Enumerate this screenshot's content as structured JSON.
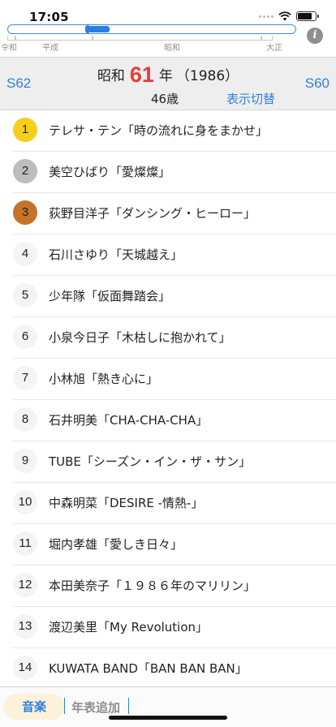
{
  "status_bar": {
    "time": "17:05"
  },
  "timeline": {
    "eras": [
      "令和",
      "平成",
      "昭和",
      "大正"
    ],
    "position_fraction": 0.31
  },
  "header": {
    "prev_label": "S62",
    "next_label": "S60",
    "era": "昭和",
    "era_year": "61",
    "nen": "年",
    "western_year": "（1986）",
    "age": "46歳",
    "toggle_label": "表示切替"
  },
  "ranking": [
    {
      "rank": "1",
      "title": "テレサ・テン「時の流れに身をまかせ」"
    },
    {
      "rank": "2",
      "title": "美空ひばり「愛燦燦」"
    },
    {
      "rank": "3",
      "title": "荻野目洋子「ダンシング・ヒーロー」"
    },
    {
      "rank": "4",
      "title": "石川さゆり「天城越え」"
    },
    {
      "rank": "5",
      "title": "少年隊「仮面舞踏会」"
    },
    {
      "rank": "6",
      "title": "小泉今日子「木枯しに抱かれて」"
    },
    {
      "rank": "7",
      "title": "小林旭「熱き心に」"
    },
    {
      "rank": "8",
      "title": "石井明美「CHA-CHA-CHA」"
    },
    {
      "rank": "9",
      "title": "TUBE「シーズン・イン・ザ・サン」"
    },
    {
      "rank": "10",
      "title": "中森明菜「DESIRE -情熱-」"
    },
    {
      "rank": "11",
      "title": "堀内孝雄「愛しき日々」"
    },
    {
      "rank": "12",
      "title": "本田美奈子「１９８６年のマリリン」"
    },
    {
      "rank": "13",
      "title": "渡辺美里「My Revolution」"
    },
    {
      "rank": "14",
      "title": "KUWATA BAND「BAN BAN BAN」"
    }
  ],
  "tabs": {
    "music": "音楽",
    "add_timeline": "年表追加"
  },
  "colors": {
    "accent": "#2f7fd9",
    "year_number": "#e83b3b",
    "gold": "#f5cf1a",
    "silver": "#bdbdbd",
    "bronze": "#c47429"
  }
}
